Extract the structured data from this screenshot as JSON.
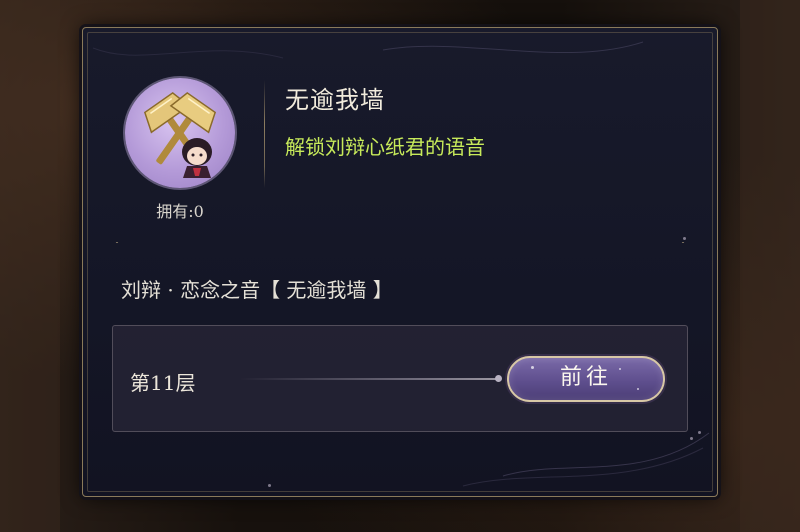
{
  "item": {
    "title": "无逾我墙",
    "description": "解锁刘辩心纸君的语音",
    "owned_text": "拥有:0",
    "icon": "golden-axes-chibi-icon"
  },
  "voice": {
    "name": "刘辩 · 恋念之音【 无逾我墙 】"
  },
  "task": {
    "floor_label": "第11层",
    "go_button_label": "前往"
  },
  "colors": {
    "description_green": "#c7ea5a",
    "panel_bg": "#181a2b",
    "button_purple": "#5f4f8e",
    "gold_border": "#8a7a5a"
  }
}
